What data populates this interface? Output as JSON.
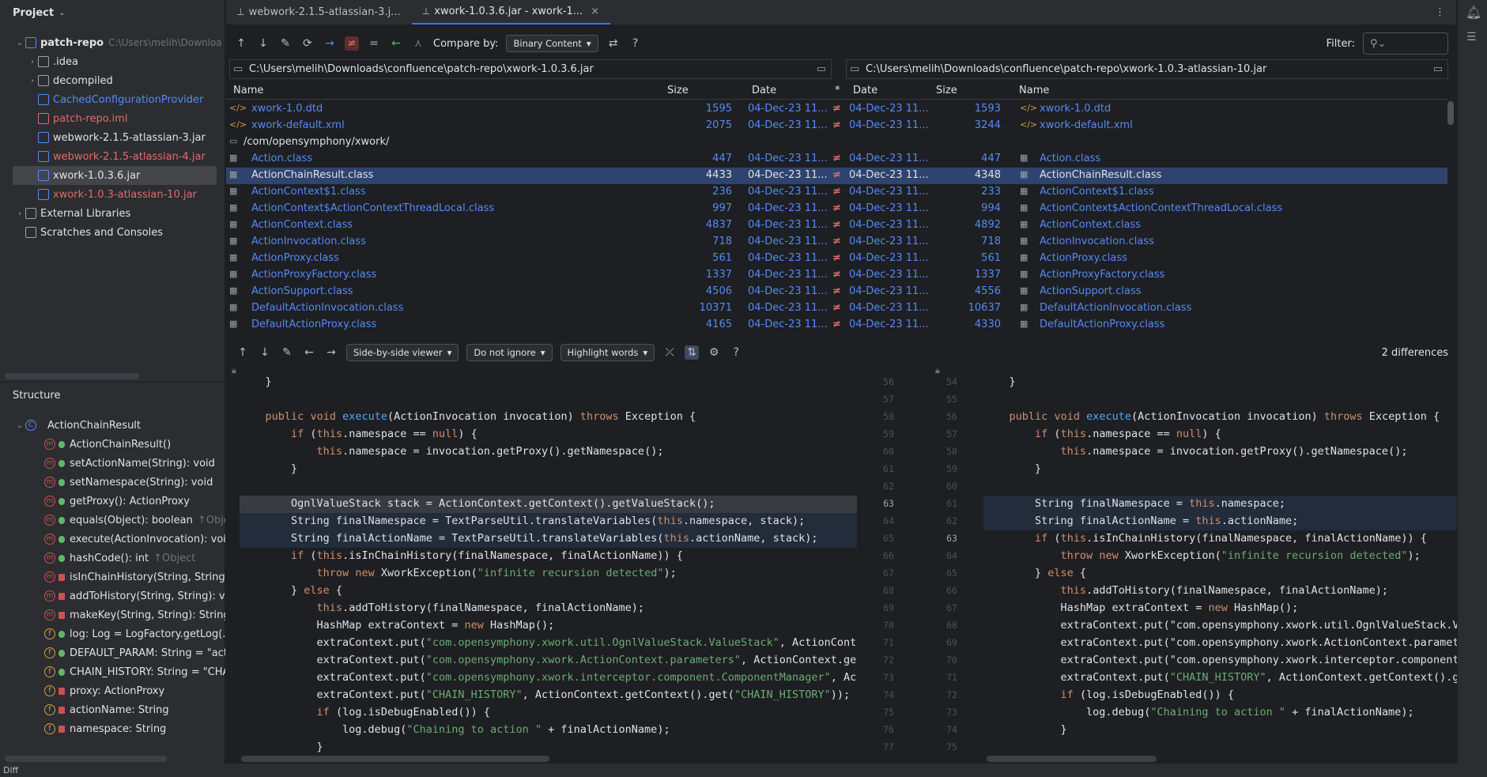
{
  "project": {
    "title": "Project",
    "items": [
      {
        "label": "patch-repo",
        "hint": "C:\\Users\\melih\\Downloa",
        "indent": 0,
        "arrow": "⌄",
        "color": "normal",
        "icon": "module-icon",
        "bold": true
      },
      {
        "label": ".idea",
        "indent": 1,
        "arrow": "›",
        "color": "normal",
        "icon": "folder-icon"
      },
      {
        "label": "decompiled",
        "indent": 1,
        "arrow": "›",
        "color": "normal",
        "icon": "folder-icon"
      },
      {
        "label": "CachedConfigurationProvider",
        "indent": 1,
        "color": "blue",
        "icon": "class-icon"
      },
      {
        "label": "patch-repo.iml",
        "indent": 1,
        "color": "red",
        "icon": "iml-icon"
      },
      {
        "label": "webwork-2.1.5-atlassian-3.jar",
        "indent": 1,
        "color": "normal",
        "icon": "jar-icon"
      },
      {
        "label": "webwork-2.1.5-atlassian-4.jar",
        "indent": 1,
        "color": "red",
        "icon": "jar-icon"
      },
      {
        "label": "xwork-1.0.3.6.jar",
        "indent": 1,
        "color": "normal",
        "icon": "jar-icon",
        "selected": true
      },
      {
        "label": "xwork-1.0.3-atlassian-10.jar",
        "indent": 1,
        "color": "red",
        "icon": "jar-icon"
      },
      {
        "label": "External Libraries",
        "indent": 0,
        "arrow": "›",
        "color": "normal",
        "icon": "library-icon"
      },
      {
        "label": "Scratches and Consoles",
        "indent": 0,
        "color": "normal",
        "icon": "scratches-icon"
      }
    ]
  },
  "structure": {
    "title": "Structure",
    "root": "ActionChainResult",
    "members": [
      {
        "kind": "m",
        "label": "ActionChainResult()"
      },
      {
        "kind": "m",
        "label": "setActionName(String): void"
      },
      {
        "kind": "m",
        "label": "setNamespace(String): void"
      },
      {
        "kind": "m",
        "label": "getProxy(): ActionProxy"
      },
      {
        "kind": "m",
        "label": "equals(Object): boolean",
        "hint": "↑Obje"
      },
      {
        "kind": "m",
        "label": "execute(ActionInvocation): voi"
      },
      {
        "kind": "m",
        "label": "hashCode(): int",
        "hint": "↑Object"
      },
      {
        "kind": "m",
        "label": "isInChainHistory(String, String)",
        "private": true
      },
      {
        "kind": "m",
        "label": "addToHistory(String, String): vo",
        "private": true
      },
      {
        "kind": "m",
        "label": "makeKey(String, String): String",
        "private": true
      },
      {
        "kind": "f",
        "label": "log: Log = LogFactory.getLog(."
      },
      {
        "kind": "f",
        "label": "DEFAULT_PARAM: String = \"act"
      },
      {
        "kind": "f",
        "label": "CHAIN_HISTORY: String = \"CHA"
      },
      {
        "kind": "f",
        "label": "proxy: ActionProxy",
        "private": true
      },
      {
        "kind": "f",
        "label": "actionName: String",
        "private": true
      },
      {
        "kind": "f",
        "label": "namespace: String",
        "private": true
      }
    ]
  },
  "tabs": [
    {
      "label": "webwork-2.1.5-atlassian-3.j..."
    },
    {
      "label": "xwork-1.0.3.6.jar - xwork-1..."
    }
  ],
  "toolbar": {
    "compare_label": "Compare by:",
    "compare_value": "Binary Content",
    "filter_label": "Filter:"
  },
  "left_path": "C:\\Users\\melih\\Downloads\\confluence\\patch-repo\\xwork-1.0.3.6.jar",
  "right_path": "C:\\Users\\melih\\Downloads\\confluence\\patch-repo\\xwork-1.0.3-atlassian-10.jar",
  "columns": {
    "name": "Name",
    "size": "Size",
    "date": "Date",
    "star": "*"
  },
  "files": [
    {
      "name": "xwork-1.0.dtd",
      "ls": "1595",
      "ld": "04-Dec-23 11...",
      "rd": "04-Dec-23 11...",
      "rs": "1593",
      "icon": "xml-icon"
    },
    {
      "name": "xwork-default.xml",
      "ls": "2075",
      "ld": "04-Dec-23 11...",
      "rd": "04-Dec-23 11...",
      "rs": "3244",
      "icon": "xml-icon"
    },
    {
      "name": "/com/opensymphony/xwork/",
      "dir": true,
      "icon": "folder-icon"
    },
    {
      "name": "Action.class",
      "ls": "447",
      "ld": "04-Dec-23 11...",
      "rd": "04-Dec-23 11...",
      "rs": "447",
      "icon": "class-file-icon"
    },
    {
      "name": "ActionChainResult.class",
      "ls": "4433",
      "ld": "04-Dec-23 11...",
      "rd": "04-Dec-23 11...",
      "rs": "4348",
      "icon": "class-file-icon",
      "selected": true
    },
    {
      "name": "ActionContext$1.class",
      "ls": "236",
      "ld": "04-Dec-23 11...",
      "rd": "04-Dec-23 11...",
      "rs": "233",
      "icon": "class-file-icon"
    },
    {
      "name": "ActionContext$ActionContextThreadLocal.class",
      "ls": "997",
      "ld": "04-Dec-23 11...",
      "rd": "04-Dec-23 11...",
      "rs": "994",
      "icon": "class-file-icon"
    },
    {
      "name": "ActionContext.class",
      "ls": "4837",
      "ld": "04-Dec-23 11...",
      "rd": "04-Dec-23 11...",
      "rs": "4892",
      "icon": "class-file-icon"
    },
    {
      "name": "ActionInvocation.class",
      "ls": "718",
      "ld": "04-Dec-23 11...",
      "rd": "04-Dec-23 11...",
      "rs": "718",
      "icon": "class-file-icon"
    },
    {
      "name": "ActionProxy.class",
      "ls": "561",
      "ld": "04-Dec-23 11...",
      "rd": "04-Dec-23 11...",
      "rs": "561",
      "icon": "class-file-icon"
    },
    {
      "name": "ActionProxyFactory.class",
      "ls": "1337",
      "ld": "04-Dec-23 11...",
      "rd": "04-Dec-23 11...",
      "rs": "1337",
      "icon": "class-file-icon"
    },
    {
      "name": "ActionSupport.class",
      "ls": "4506",
      "ld": "04-Dec-23 11...",
      "rd": "04-Dec-23 11...",
      "rs": "4556",
      "icon": "class-file-icon"
    },
    {
      "name": "DefaultActionInvocation.class",
      "ls": "10371",
      "ld": "04-Dec-23 11...",
      "rd": "04-Dec-23 11...",
      "rs": "10637",
      "icon": "class-file-icon"
    },
    {
      "name": "DefaultActionProxy.class",
      "ls": "4165",
      "ld": "04-Dec-23 11...",
      "rd": "04-Dec-23 11...",
      "rs": "4330",
      "icon": "class-file-icon"
    }
  ],
  "diff_toolbar": {
    "viewer": "Side-by-side viewer",
    "ignore": "Do not ignore",
    "highlight": "Highlight words",
    "count": "2 differences"
  },
  "left_lines": [
    "56",
    "57",
    "58",
    "59",
    "60",
    "61",
    "62",
    "63",
    "64",
    "65",
    "66",
    "67",
    "68",
    "69",
    "70",
    "71",
    "72",
    "73",
    "74",
    "75",
    "76",
    "77"
  ],
  "right_lines": [
    "54",
    "55",
    "56",
    "57",
    "58",
    "59",
    "60",
    "61",
    "62",
    "63",
    "64",
    "65",
    "66",
    "67",
    "68",
    "69",
    "70",
    "71",
    "72",
    "73",
    "74",
    "75"
  ],
  "left_code": [
    "    }",
    "",
    "    public void execute(ActionInvocation invocation) throws Exception {",
    "        if (this.namespace == null) {",
    "            this.namespace = invocation.getProxy().getNamespace();",
    "        }",
    "",
    "        OgnlValueStack stack = ActionContext.getContext().getValueStack();",
    "        String finalNamespace = TextParseUtil.translateVariables(this.namespace, stack);",
    "        String finalActionName = TextParseUtil.translateVariables(this.actionName, stack);",
    "        if (this.isInChainHistory(finalNamespace, finalActionName)) {",
    "            throw new XworkException(\"infinite recursion detected\");",
    "        } else {",
    "            this.addToHistory(finalNamespace, finalActionName);",
    "            HashMap extraContext = new HashMap();",
    "            extraContext.put(\"com.opensymphony.xwork.util.OgnlValueStack.ValueStack\", ActionConte",
    "            extraContext.put(\"com.opensymphony.xwork.ActionContext.parameters\", ActionContext.get",
    "            extraContext.put(\"com.opensymphony.xwork.interceptor.component.ComponentManager\", Act",
    "            extraContext.put(\"CHAIN_HISTORY\", ActionContext.getContext().get(\"CHAIN_HISTORY\"));",
    "            if (log.isDebugEnabled()) {",
    "                log.debug(\"Chaining to action \" + finalActionName);",
    "            }"
  ],
  "right_code": [
    "    }",
    "",
    "    public void execute(ActionInvocation invocation) throws Exception {",
    "        if (this.namespace == null) {",
    "            this.namespace = invocation.getProxy().getNamespace();",
    "        }",
    "",
    "        String finalNamespace = this.namespace;",
    "        String finalActionName = this.actionName;",
    "        if (this.isInChainHistory(finalNamespace, finalActionName)) {",
    "            throw new XworkException(\"infinite recursion detected\");",
    "        } else {",
    "            this.addToHistory(finalNamespace, finalActionName);",
    "            HashMap extraContext = new HashMap();",
    "            extraContext.put(\"com.opensymphony.xwork.util.OgnlValueStack.Va",
    "            extraContext.put(\"com.opensymphony.xwork.ActionContext.paramete",
    "            extraContext.put(\"com.opensymphony.xwork.interceptor.component",
    "            extraContext.put(\"CHAIN_HISTORY\", ActionContext.getContext().ge",
    "            if (log.isDebugEnabled()) {",
    "                log.debug(\"Chaining to action \" + finalActionName);",
    "            }",
    ""
  ],
  "status": "Diff"
}
